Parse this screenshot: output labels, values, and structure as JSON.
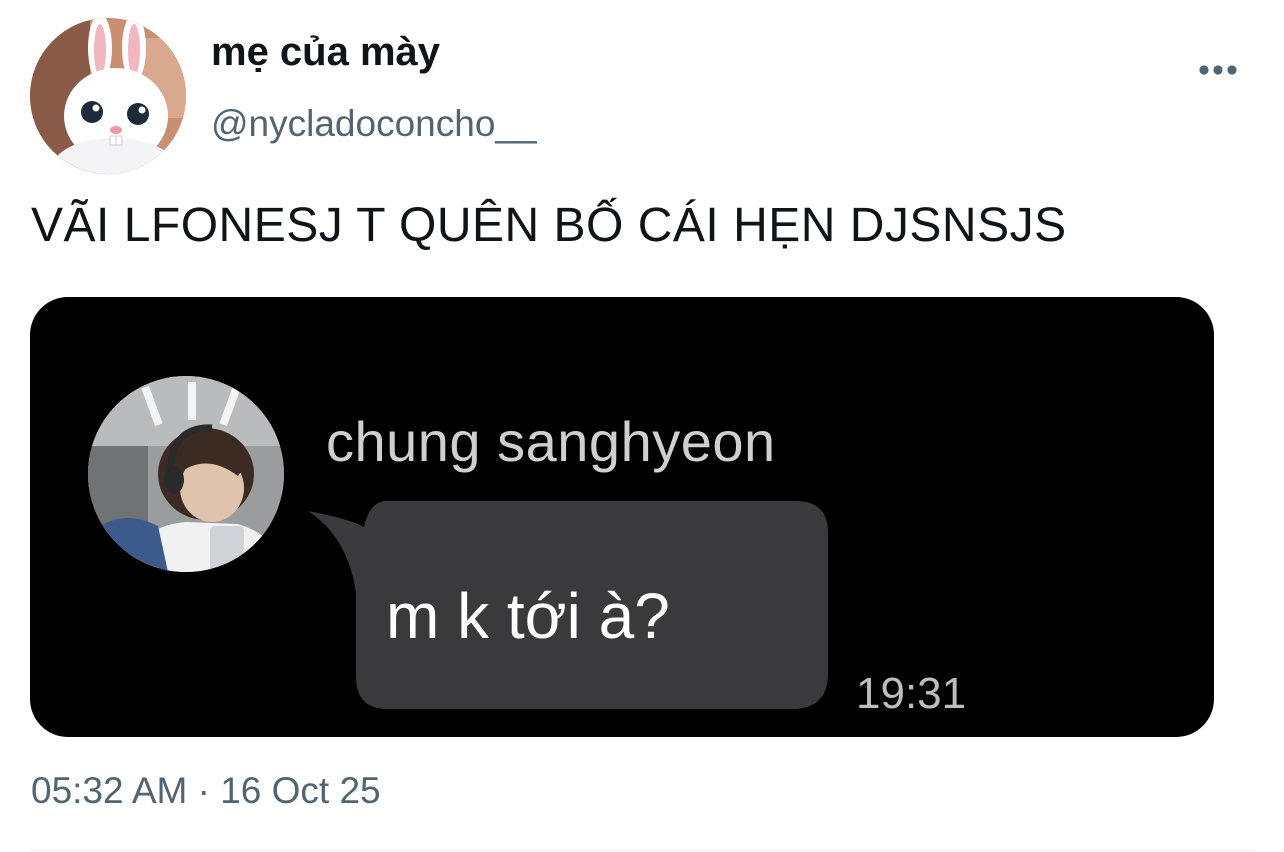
{
  "tweet": {
    "author": {
      "display_name": "mẹ của mày",
      "handle": "@nycladoconcho__"
    },
    "more_icon": "more-horizontal-icon",
    "text": "VÃI LFONESJ T QUÊN BỐ CÁI HẸN DJSNSJS",
    "timestamp": "05:32 AM · 16 Oct 25"
  },
  "screenshot": {
    "sender_name": "chung sanghyeon",
    "message": "m k tới à?",
    "time": "19:31",
    "bubble_color": "#3a3a3c"
  },
  "colors": {
    "text_primary": "#0f1419",
    "text_secondary": "#536471",
    "media_background": "#000000"
  }
}
